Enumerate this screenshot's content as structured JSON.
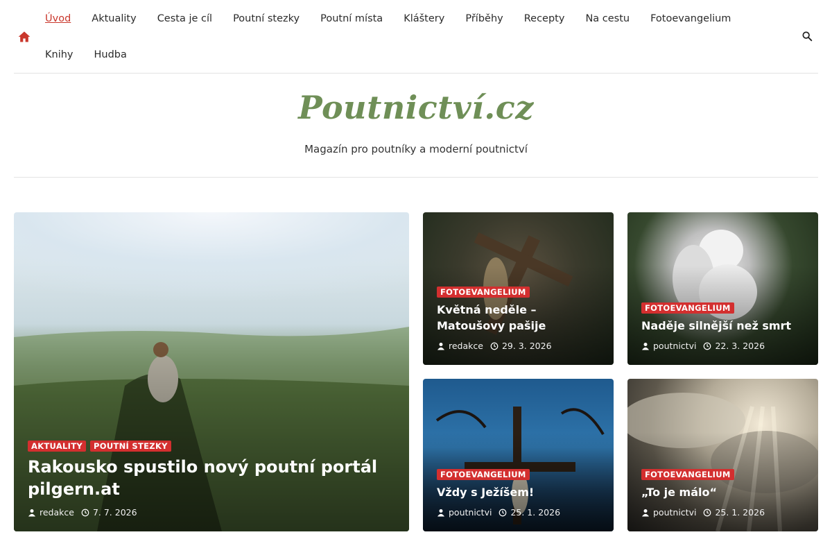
{
  "nav": {
    "home_icon": "home-icon",
    "search_icon": "search-icon",
    "items": [
      "Úvod",
      "Aktuality",
      "Cesta je cíl",
      "Poutní stezky",
      "Poutní místa",
      "Kláštery",
      "Příběhy",
      "Recepty",
      "Na cestu",
      "Fotoevangelium",
      "Knihy",
      "Hudba"
    ],
    "active": "Úvod"
  },
  "branding": {
    "logo": "Poutnictví.cz",
    "tagline": "Magazín pro poutníky a moderní poutnictví"
  },
  "colors": {
    "accent": "#c9372c",
    "category_badge": "#d32f2f",
    "logo_green": "#6f8f57"
  },
  "posts": [
    {
      "categories": [
        "AKTUALITY",
        "POUTNÍ STEZKY"
      ],
      "title": "Rakousko spustilo nový poutní portál pilgern.at",
      "author": "redakce",
      "date": "7. 7. 2026"
    },
    {
      "categories": [
        "FOTOEVANGELIUM"
      ],
      "title": "Květná neděle – Matoušovy pašije",
      "author": "redakce",
      "date": "29. 3. 2026"
    },
    {
      "categories": [
        "FOTOEVANGELIUM"
      ],
      "title": "Naděje silnější než smrt",
      "author": "poutnictvi",
      "date": "22. 3. 2026"
    },
    {
      "categories": [
        "FOTOEVANGELIUM"
      ],
      "title": "Vždy s Ježíšem!",
      "author": "poutnictvi",
      "date": "25. 1. 2026"
    },
    {
      "categories": [
        "FOTOEVANGELIUM"
      ],
      "title": "„To je málo“",
      "author": "poutnictvi",
      "date": "25. 1. 2026"
    }
  ]
}
